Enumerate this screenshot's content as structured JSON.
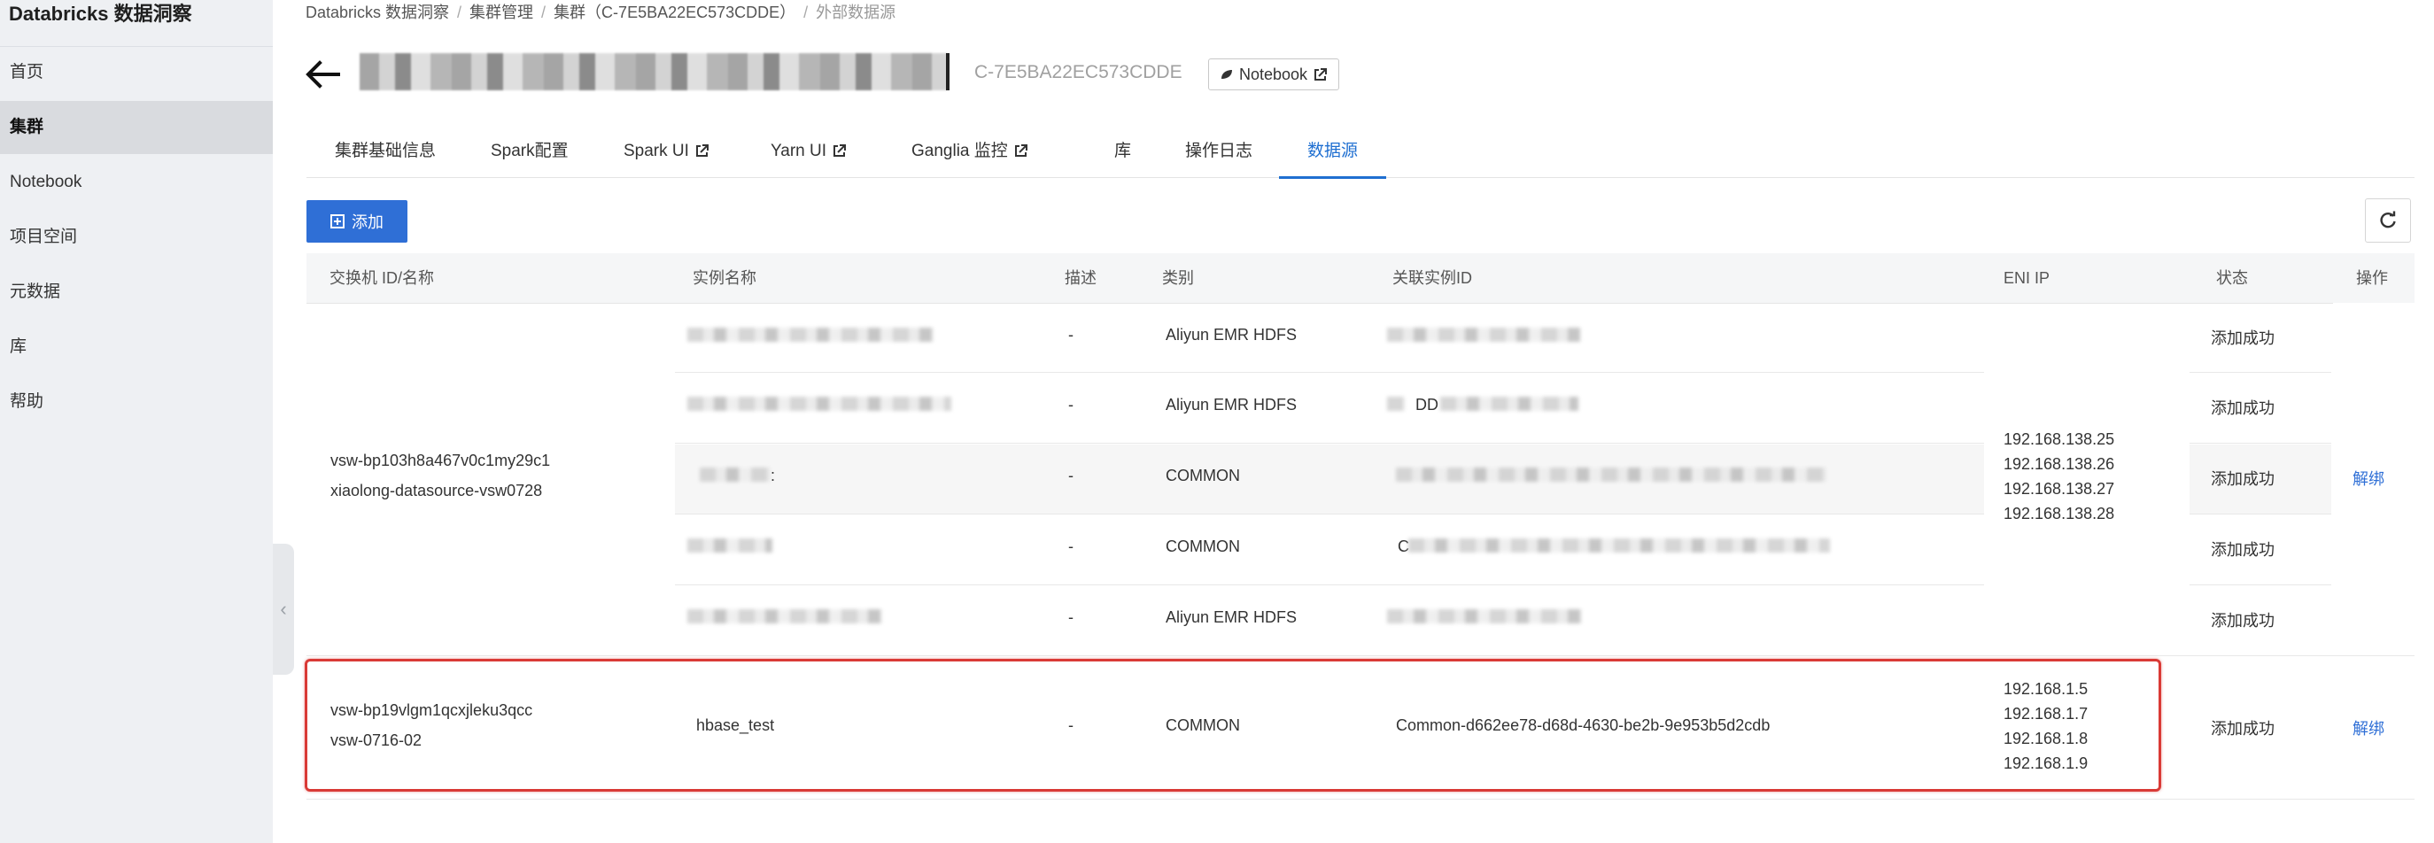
{
  "sidebar": {
    "brand": "Databricks 数据洞察",
    "items": [
      {
        "label": "首页",
        "active": false
      },
      {
        "label": "集群",
        "active": true
      },
      {
        "label": "Notebook",
        "active": false
      },
      {
        "label": "项目空间",
        "active": false
      },
      {
        "label": "元数据",
        "active": false
      },
      {
        "label": "库",
        "active": false
      },
      {
        "label": "帮助",
        "active": false
      }
    ]
  },
  "breadcrumb": {
    "items": [
      "Databricks 数据洞察",
      "集群管理",
      "集群（C-7E5BA22EC573CDDE）",
      "外部数据源"
    ],
    "separator": "/"
  },
  "header": {
    "cluster_id": "C-7E5BA22EC573CDDE",
    "notebook_button": "Notebook"
  },
  "tabs": [
    {
      "label": "集群基础信息",
      "external": false,
      "active": false
    },
    {
      "label": "Spark配置",
      "external": false,
      "active": false
    },
    {
      "label": "Spark UI",
      "external": true,
      "active": false
    },
    {
      "label": "Yarn UI",
      "external": true,
      "active": false
    },
    {
      "label": "Ganglia 监控",
      "external": true,
      "active": false
    },
    {
      "label": "库",
      "external": false,
      "active": false
    },
    {
      "label": "操作日志",
      "external": false,
      "active": false
    },
    {
      "label": "数据源",
      "external": false,
      "active": true
    }
  ],
  "toolbar": {
    "add_label": "添加"
  },
  "table": {
    "columns": [
      "交换机 ID/名称",
      "实例名称",
      "描述",
      "类别",
      "关联实例ID",
      "ENI IP",
      "状态",
      "操作"
    ],
    "groups": [
      {
        "switch_id": "vsw-bp103h8a467v0c1my29c1",
        "switch_name": "xiaolong-datasource-vsw0728",
        "eni_ips": [
          "192.168.138.25",
          "192.168.138.26",
          "192.168.138.27",
          "192.168.138.28"
        ],
        "action": "解绑",
        "rows": [
          {
            "instance_name": "",
            "description": "-",
            "category": "Aliyun EMR HDFS",
            "related_id": "",
            "status": "添加成功"
          },
          {
            "instance_name": "",
            "description": "-",
            "category": "Aliyun EMR HDFS",
            "related_id": "DD",
            "status": "添加成功"
          },
          {
            "instance_name": ":",
            "description": "-",
            "category": "COMMON",
            "related_id": "",
            "status": "添加成功"
          },
          {
            "instance_name": "",
            "description": "-",
            "category": "COMMON",
            "related_id": "C",
            "status": "添加成功"
          },
          {
            "instance_name": "",
            "description": "-",
            "category": "Aliyun EMR HDFS",
            "related_id": "",
            "status": "添加成功"
          }
        ]
      },
      {
        "switch_id": "vsw-bp19vlgm1qcxjleku3qcc",
        "switch_name": "vsw-0716-02",
        "eni_ips": [
          "192.168.1.5",
          "192.168.1.7",
          "192.168.1.8",
          "192.168.1.9"
        ],
        "action": "解绑",
        "rows": [
          {
            "instance_name": "hbase_test",
            "description": "-",
            "category": "COMMON",
            "related_id": "Common-d662ee78-d68d-4630-be2b-9e953b5d2cdb",
            "status": "添加成功"
          }
        ]
      }
    ]
  },
  "colors": {
    "accent": "#2f6fd6",
    "highlight": "#d93a36",
    "sidebar_bg": "#eef0f3"
  }
}
